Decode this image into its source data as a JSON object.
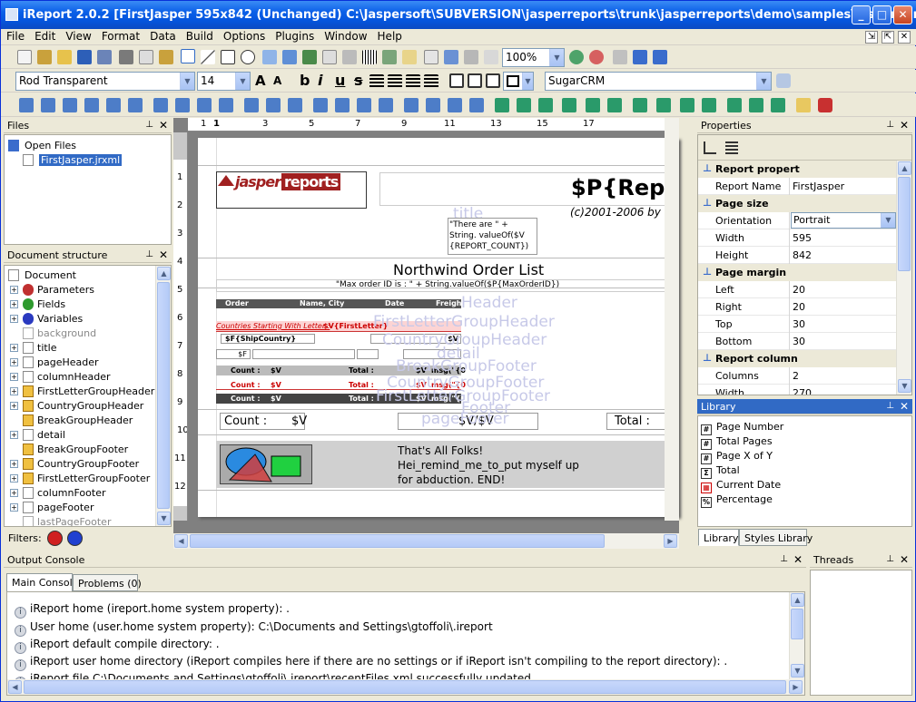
{
  "window": {
    "title": "iReport 2.0.2  [FirstJasper 595x842 (Unchanged) C:\\Jaspersoft\\SUBVERSION\\jasperreports\\trunk\\jasperreports\\demo\\samples\\jasper\\FirstJasp..."
  },
  "menu": [
    "File",
    "Edit",
    "View",
    "Format",
    "Data",
    "Build",
    "Options",
    "Plugins",
    "Window",
    "Help"
  ],
  "toolbar": {
    "zoom": "100%",
    "font_style": "Rod Transparent",
    "font_size": "14",
    "format_buttons": [
      "A",
      "A",
      "b",
      "i",
      "u",
      "s"
    ],
    "font_name": "SugarCRM"
  },
  "files_panel": {
    "title": "Files",
    "root": "Open Files",
    "file": "FirstJasper.jrxml"
  },
  "doc_panel": {
    "title": "Document structure",
    "items": [
      "Document",
      "Parameters",
      "Fields",
      "Variables",
      "background",
      "title",
      "pageHeader",
      "columnHeader",
      "FirstLetterGroupHeader",
      "CountryGroupHeader",
      "BreakGroupHeader",
      "detail",
      "BreakGroupFooter",
      "CountryGroupFooter",
      "FirstLetterGroupFooter",
      "columnFooter",
      "pageFooter",
      "lastPageFooter"
    ],
    "filters_label": "Filters:"
  },
  "ruler": {
    "numbers": [
      "1",
      "1",
      "3",
      "5",
      "7",
      "9",
      "11",
      "13",
      "15",
      "17"
    ],
    "v_numbers": [
      "1",
      "2",
      "3",
      "4",
      "5",
      "6",
      "7",
      "8",
      "9",
      "10",
      "11",
      "12"
    ]
  },
  "report": {
    "logo_left": "jasper",
    "logo_right": "reports",
    "title_param": "$P{ReportT",
    "copyright": "(c)2001-2006 by",
    "title_band_label": "title",
    "count_expr": "\"There are \" + String. valueOf($V {REPORT_COUNT})",
    "heading": "Northwind Order List",
    "max_order": "\"Max order ID is : \" + String.valueOf($P{MaxOrderID})",
    "col_headers": [
      "Order",
      "Name, City",
      "Date",
      "Freight"
    ],
    "col_header_band": "Header",
    "first_letter_label": "Countries Starting With Letter :",
    "first_letter_field": "$V{FirstLetter}",
    "first_letter_band": "FirstLetterGroupHeader",
    "ship_country": "$F{ShipCountry}",
    "ship_v": "$V",
    "country_band": "CountryGroupHeader",
    "detail_f": "$F",
    "detail_band": "detail",
    "summary_rows": [
      [
        "Count :",
        "$V",
        "Total :",
        "$V",
        "msg(\"{0"
      ],
      [
        "Count :",
        "$V",
        "Total :",
        "$V",
        "msg(\"{0"
      ],
      [
        "Count :",
        "$V",
        "Total :",
        "$V",
        "msg(\"{0"
      ]
    ],
    "break_footer_band": "BreakGroupFooter",
    "country_footer_band": "CountryGroupFooter",
    "first_letter_footer_band": "FirstLetterGroupFooter",
    "column_footer_band": "Footer",
    "page_footer_band": "pageFooter",
    "footer_count": "Count :",
    "footer_v1": "$V",
    "footer_v2": "$V/$V",
    "footer_total": "Total :",
    "summary_text": "That's All Folks!\nHei_remind_me_to_put myself up\nfor abduction. END!"
  },
  "properties": {
    "title": "Properties",
    "rows": [
      {
        "cat": "Report propert"
      },
      {
        "name": "Report Name",
        "value": "FirstJasper"
      },
      {
        "cat": "Page size"
      },
      {
        "name": "Orientation",
        "value": "Portrait"
      },
      {
        "name": "Width",
        "value": "595"
      },
      {
        "name": "Height",
        "value": "842"
      },
      {
        "cat": "Page margin"
      },
      {
        "name": "Left",
        "value": "20"
      },
      {
        "name": "Right",
        "value": "20"
      },
      {
        "name": "Top",
        "value": "30"
      },
      {
        "name": "Bottom",
        "value": "30"
      },
      {
        "cat": "Report column"
      },
      {
        "name": "Columns",
        "value": "2"
      },
      {
        "name": "Width",
        "value": "270"
      }
    ]
  },
  "library": {
    "title": "Library",
    "items": [
      {
        "icon": "#",
        "label": "Page Number"
      },
      {
        "icon": "#",
        "label": "Total Pages"
      },
      {
        "icon": "#",
        "label": "Page X of Y"
      },
      {
        "icon": "Σ",
        "label": "Total"
      },
      {
        "icon": "▦",
        "label": "Current Date"
      },
      {
        "icon": "%",
        "label": "Percentage"
      }
    ],
    "tabs": [
      "Library",
      "Styles Library"
    ]
  },
  "console": {
    "title": "Output Console",
    "tabs": [
      "Main Console",
      "Problems (0)"
    ],
    "lines": [
      "iReport home (ireport.home system property): .",
      "User home (user.home system property): C:\\Documents and Settings\\gtoffoli\\.ireport",
      "iReport default compile directory: .",
      "iReport user home directory (iReport compiles here if there are no settings or if iReport isn't compiling to the report directory): .",
      "iReport file C:\\Documents and Settings\\gtoffoli\\.ireport\\recentFiles.xml successfully updated"
    ]
  },
  "threads": {
    "title": "Threads"
  }
}
